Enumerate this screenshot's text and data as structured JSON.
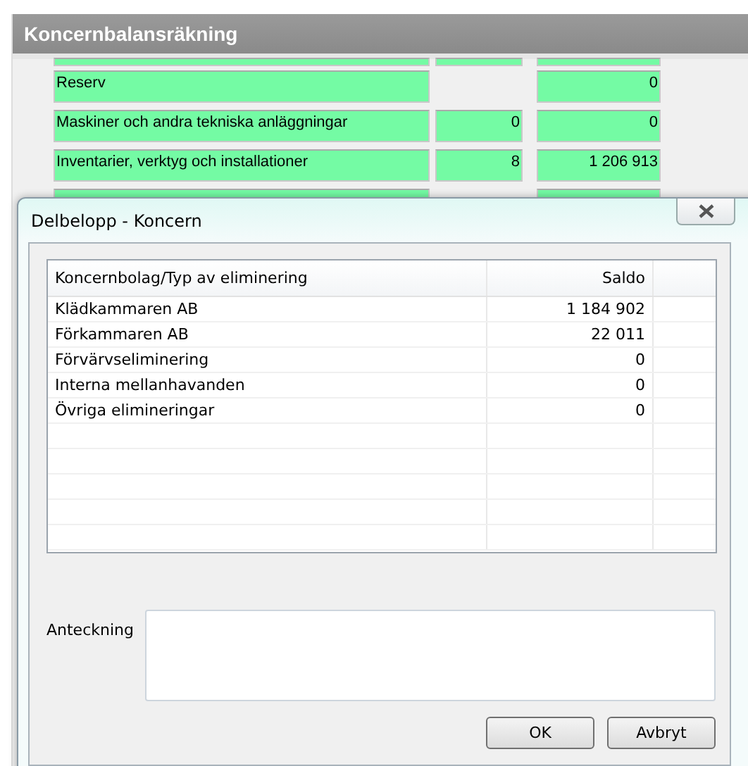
{
  "window": {
    "title": "Koncernbalansräkning"
  },
  "rows": [
    {
      "label": "Reserv",
      "column_2": "",
      "column_3": "0"
    },
    {
      "label": "Maskiner och andra tekniska anläggningar",
      "column_2": "0",
      "column_3": "0"
    },
    {
      "label": "Inventarier, verktyg och installationer",
      "column_2": "8",
      "column_3": "1 206 913"
    }
  ],
  "dialog": {
    "title": "Delbelopp - Koncern",
    "table": {
      "columns": [
        "Koncernbolag/Typ av eliminering",
        "Saldo"
      ],
      "rows": [
        [
          "Klädkammaren AB",
          "1 184 902"
        ],
        [
          "Förkammaren AB",
          "22 011"
        ],
        [
          "Förvärvseliminering",
          "0"
        ],
        [
          "Interna mellanhavanden",
          "0"
        ],
        [
          "Övriga elimineringar",
          "0"
        ]
      ]
    },
    "note_label": "Anteckning",
    "buttons": [
      "OK",
      "Avbryt"
    ]
  }
}
